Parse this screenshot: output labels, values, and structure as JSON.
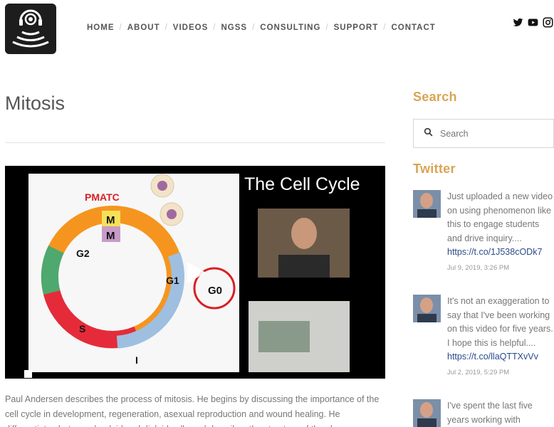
{
  "header": {
    "logo_alt": "Bozeman Science logo",
    "nav": [
      {
        "label": "HOME"
      },
      {
        "label": "ABOUT"
      },
      {
        "label": "VIDEOS"
      },
      {
        "label": "NGSS"
      },
      {
        "label": "CONSULTING"
      },
      {
        "label": "SUPPORT"
      },
      {
        "label": "CONTACT"
      }
    ],
    "social": [
      "twitter-icon",
      "youtube-icon",
      "instagram-icon"
    ]
  },
  "main": {
    "title": "Mitosis",
    "video": {
      "heading": "The Cell Cycle",
      "phase_labels": {
        "pmatc": "PMATC",
        "m1": "M",
        "m2": "M",
        "g2": "G2",
        "g1": "G1",
        "g0": "G0",
        "s": "S",
        "i": "I"
      }
    },
    "description": "Paul Andersen describes the process of mitosis. He begins by discussing the importance of the cell cycle in development, regeneration, asexual reproduction and wound healing. He differentiates between haploid and diploid cells and describes the structure of the chromosome."
  },
  "sidebar": {
    "search_heading": "Search",
    "search_placeholder": "Search",
    "twitter_heading": "Twitter",
    "tweets": [
      {
        "text": "Just uploaded a new video on using phenomenon like this to engage students and drive inquiry....",
        "link": "https://t.co/1J538cODk7",
        "date": "Jul 9, 2019, 3:26 PM"
      },
      {
        "text": "It's not an exaggeration to say that I've been working on this video for five years. I hope this is helpful....",
        "link": "https://t.co/llaQTTXvVv",
        "date": "Jul 2, 2019, 5:29 PM"
      },
      {
        "text": "I've spent the last five years working with",
        "link": "",
        "date": ""
      }
    ]
  }
}
